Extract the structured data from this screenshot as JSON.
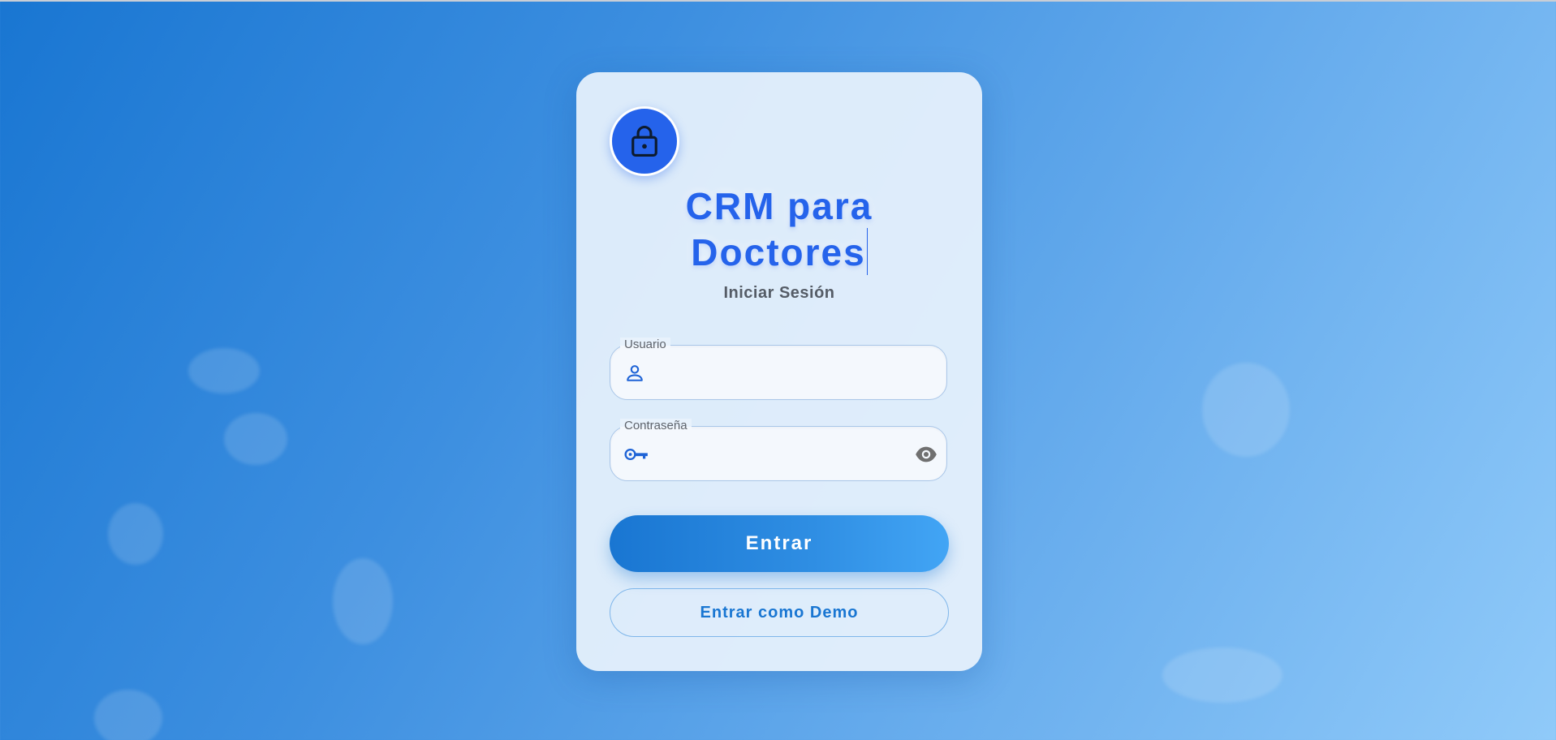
{
  "app": {
    "title_line1": "CRM para",
    "title_line2": "Doctores",
    "subtitle": "Iniciar Sesión"
  },
  "form": {
    "username": {
      "label": "Usuario",
      "value": "",
      "icon": "person-icon"
    },
    "password": {
      "label": "Contraseña",
      "value": "",
      "icon": "key-icon",
      "toggle_icon": "eye-icon"
    }
  },
  "buttons": {
    "login_label": "Entrar",
    "demo_label": "Entrar como Demo"
  },
  "colors": {
    "primary": "#2563eb",
    "button_gradient_start": "#1976d2",
    "button_gradient_end": "#42a5f5",
    "background_start": "#1976d2",
    "background_end": "#90caf9"
  }
}
